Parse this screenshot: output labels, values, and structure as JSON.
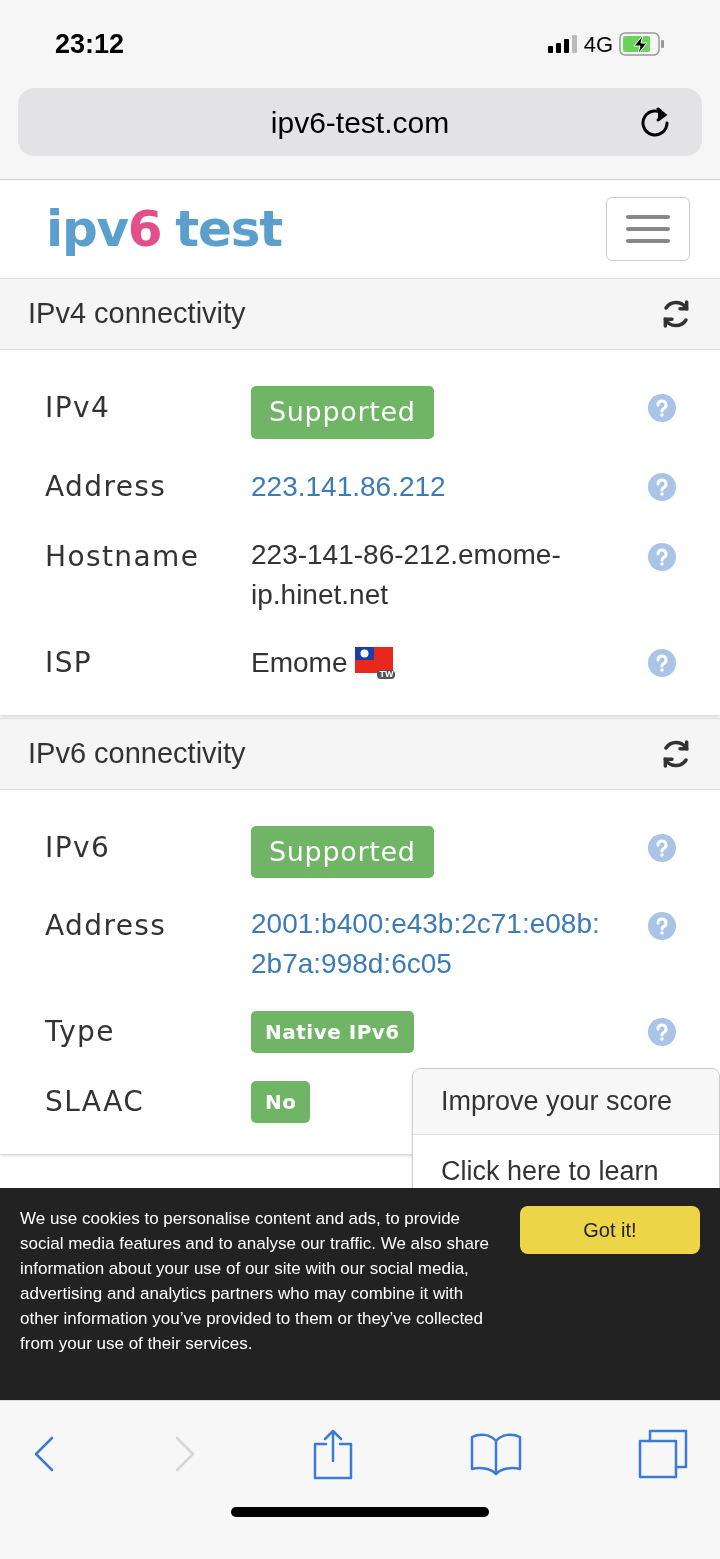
{
  "status_bar": {
    "time": "23:12",
    "network": "4G"
  },
  "url_bar": {
    "url": "ipv6-test.com"
  },
  "logo": {
    "prefix": "ipv",
    "highlight": "6",
    "suffix": "test"
  },
  "sections": [
    {
      "title": "IPv4 connectivity",
      "rows": [
        {
          "label": "IPv4",
          "kind": "large_badge",
          "value": "Supported"
        },
        {
          "label": "Address",
          "kind": "link",
          "value": "223.141.86.212"
        },
        {
          "label": "Hostname",
          "kind": "text",
          "value": "223-141-86-212.emome-ip.hinet.net"
        },
        {
          "label": "ISP",
          "kind": "text",
          "value": "Emome",
          "flag_code": "TW"
        }
      ]
    },
    {
      "title": "IPv6 connectivity",
      "rows": [
        {
          "label": "IPv6",
          "kind": "large_badge",
          "value": "Supported"
        },
        {
          "label": "Address",
          "kind": "link",
          "value": "2001:b400:e43b:2c71:e08b:2b7a:998d:6c05"
        },
        {
          "label": "Type",
          "kind": "small_badge",
          "value": "Native IPv6"
        },
        {
          "label": "SLAAC",
          "kind": "small_badge",
          "value": "No",
          "help_hidden": true
        }
      ]
    }
  ],
  "popover": {
    "title": "Improve your score",
    "text": "Click here to learn"
  },
  "cookie_banner": {
    "text": "We use cookies to personalise content and ads, to provide social media features and to analyse our traffic. We also share information about your use of our site with our social media, advertising and analytics partners who may combine it with other information you’ve provided to them or they’ve collected from your use of their services.",
    "button": "Got it!"
  },
  "toolbar": [
    {
      "kind": "back",
      "disabled": false
    },
    {
      "kind": "forward",
      "disabled": true
    },
    {
      "kind": "share",
      "disabled": false
    },
    {
      "kind": "bookmarks",
      "disabled": false
    },
    {
      "kind": "tabs",
      "disabled": false
    }
  ]
}
